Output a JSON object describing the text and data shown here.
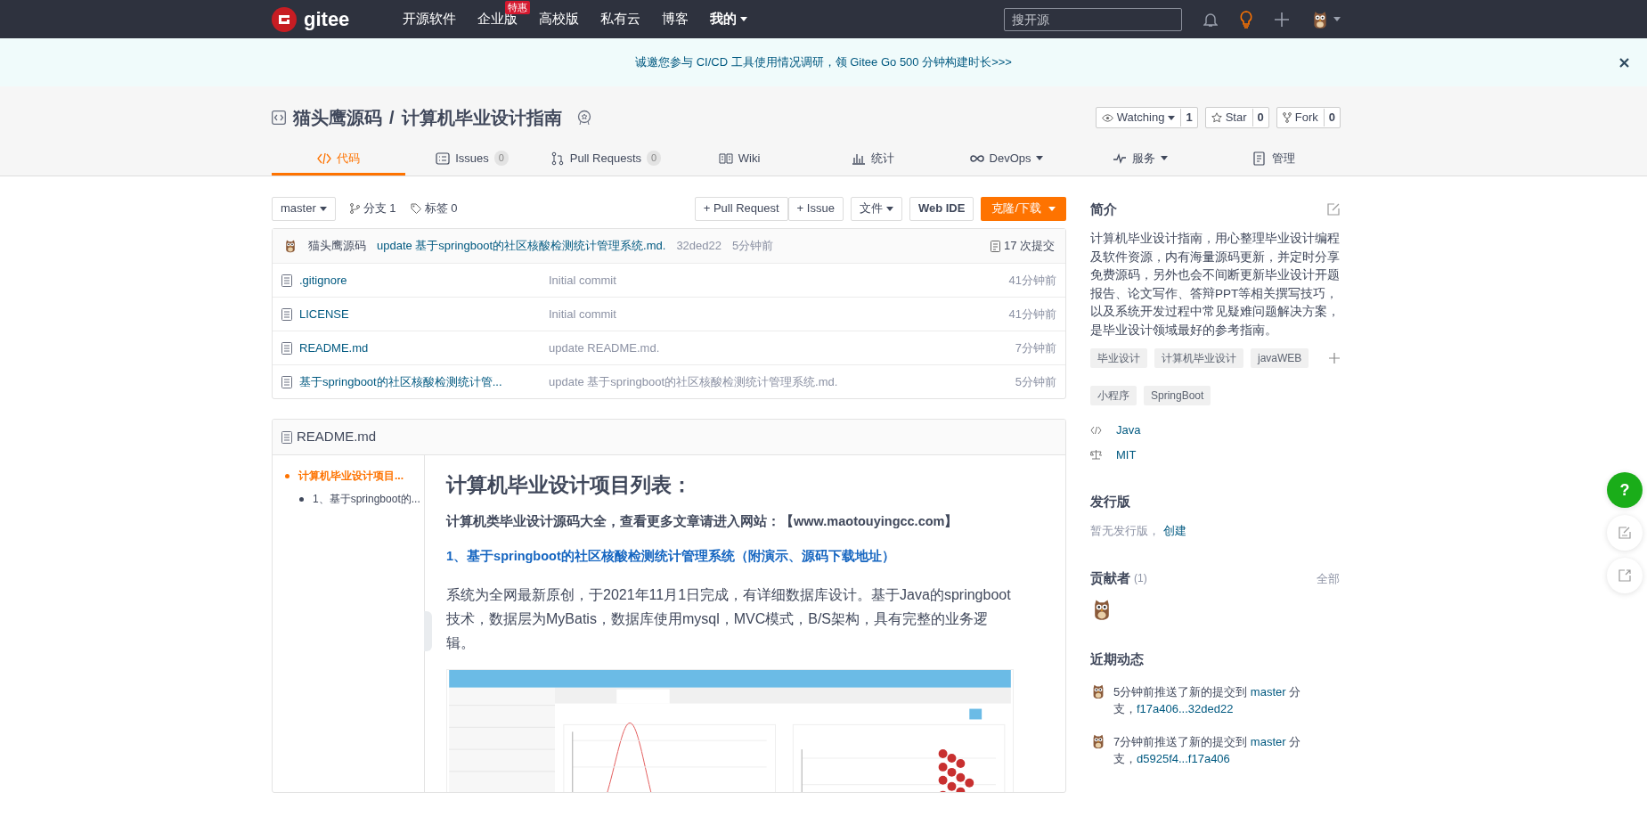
{
  "navbar": {
    "logo": "gitee",
    "items": [
      {
        "label": "开源软件"
      },
      {
        "label": "企业版",
        "badge": "特惠"
      },
      {
        "label": "高校版"
      },
      {
        "label": "私有云"
      },
      {
        "label": "博客"
      }
    ],
    "menu": "我的",
    "search": {
      "placeholder": "搜开源"
    }
  },
  "banner": {
    "text": "诚邀您参与 CI/CD 工具使用情况调研，领 Gitee Go 500 分钟构建时长>>>"
  },
  "repo": {
    "owner": "猫头鹰源码",
    "separator": "/",
    "name": "计算机毕业设计指南",
    "actions": [
      {
        "label": "Watching",
        "count": "1",
        "dropdown": true
      },
      {
        "label": "Star",
        "count": "0",
        "dropdown": false
      },
      {
        "label": "Fork",
        "count": "0",
        "dropdown": false
      }
    ]
  },
  "tabs": [
    {
      "label": "代码",
      "dropdown": false,
      "selected": true
    },
    {
      "label": "Issues",
      "count": "0",
      "dropdown": false,
      "selected": false
    },
    {
      "label": "Pull Requests",
      "count": "0",
      "dropdown": false,
      "selected": false
    },
    {
      "label": "Wiki",
      "dropdown": false,
      "selected": false
    },
    {
      "label": "统计",
      "dropdown": false,
      "selected": false
    },
    {
      "label": "DevOps",
      "dropdown": true,
      "selected": false
    },
    {
      "label": "服务",
      "dropdown": true,
      "selected": false
    },
    {
      "label": "管理",
      "dropdown": false,
      "selected": false
    }
  ],
  "toolbar": {
    "branch": "master",
    "branches": "分支 1",
    "tags": "标签 0",
    "buttons": [
      "+ Pull Request",
      "+ Issue"
    ],
    "file_menu": "文件",
    "web_ide": "Web IDE",
    "clone": "克隆/下载"
  },
  "commit": {
    "author": "猫头鹰源码",
    "message": "update 基于springboot的社区核酸检测统计管理系统.md.",
    "hash": "32ded22",
    "time": "5分钟前",
    "count": "17 次提交"
  },
  "files": [
    {
      "name": ".gitignore",
      "message": "Initial commit",
      "time": "41分钟前"
    },
    {
      "name": "LICENSE",
      "message": "Initial commit",
      "time": "41分钟前"
    },
    {
      "name": "README.md",
      "message": "update README.md.",
      "time": "7分钟前"
    },
    {
      "name": "基于springboot的社区核酸检测统计管...",
      "message": "update 基于springboot的社区核酸检测统计管理系统.md.",
      "time": "5分钟前"
    }
  ],
  "readme": {
    "title": "README.md",
    "toc": [
      {
        "text": "计算机毕业设计项目...",
        "selected": true,
        "children": [
          {
            "text": "1、基于springboot的...",
            "selected": false
          }
        ]
      }
    ],
    "heading": "计算机毕业设计项目列表：",
    "subheading": "计算机类毕业设计源码大全，查看更多文章请进入网站：【www.maotouyingcc.com】",
    "link_heading": "1、基于springboot的社区核酸检测统计管理系统（附演示、源码下载地址）",
    "paragraph": "系统为全网最新原创，于2021年11月1日完成，有详细数据库设计。基于Java的springboot技术，数据层为MyBatis，数据库使用mysql，MVC模式，B/S架构，具有完整的业务逻辑。"
  },
  "sidebar": {
    "intro_title": "简介",
    "description": "计算机毕业设计指南，用心整理毕业设计编程及软件资源，内有海量源码更新，并定时分享免费源码，另外也会不间断更新毕业设计开题报告、论文写作、答辩PPT等相关撰写技巧，以及系统开发过程中常见疑难问题解决方案，是毕业设计领域最好的参考指南。",
    "tags": [
      "毕业设计",
      "计算机毕业设计",
      "javaWEB",
      "小程序",
      "SpringBoot"
    ],
    "language": "Java",
    "license": "MIT",
    "releases_title": "发行版",
    "releases_text": "暂无发行版，",
    "releases_link": "创建",
    "contributors_title": "贡献者",
    "contributors_count": "(1)",
    "contributors_all": "全部",
    "activity_title": "近期动态",
    "activity": [
      {
        "text": "5分钟前推送了新的提交到 ",
        "branch": "master",
        "suffix": " 分支，",
        "range": "f17a406...32ded22"
      },
      {
        "text": "7分钟前推送了新的提交到 ",
        "branch": "master",
        "suffix": " 分支，",
        "range": "d5925f4...f17a406"
      }
    ]
  },
  "float_buttons": {
    "help": "?"
  }
}
